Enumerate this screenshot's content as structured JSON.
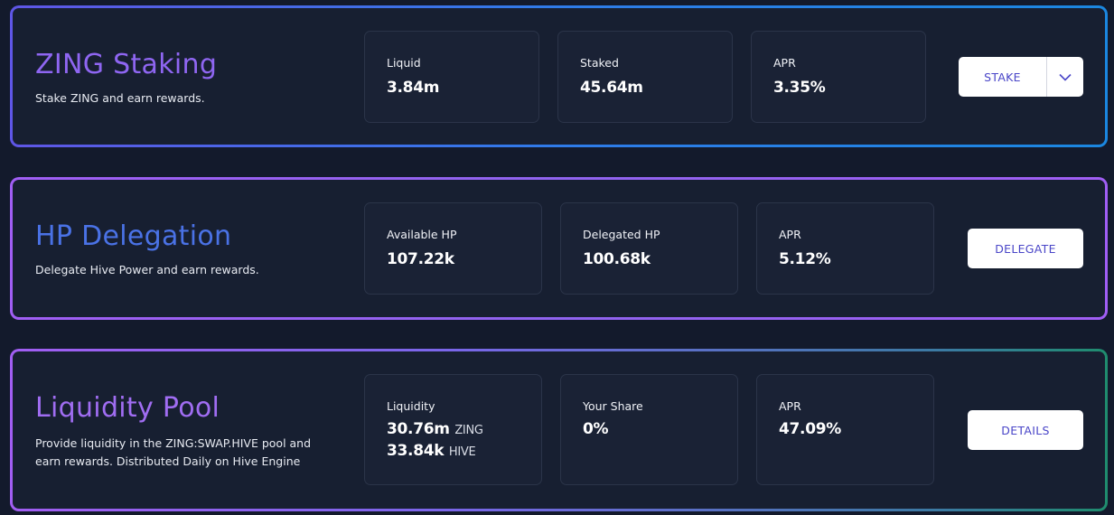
{
  "staking": {
    "title": "ZING Staking",
    "description": "Stake ZING and earn rewards.",
    "stats": [
      {
        "label": "Liquid",
        "value": "3.84m"
      },
      {
        "label": "Staked",
        "value": "45.64m"
      },
      {
        "label": "APR",
        "value": "3.35%"
      }
    ],
    "button_label": "STAKE",
    "dropdown_icon": "chevron-down-icon"
  },
  "delegation": {
    "title": "HP Delegation",
    "description": "Delegate Hive Power and earn rewards.",
    "stats": [
      {
        "label": "Available HP",
        "value": "107.22k"
      },
      {
        "label": "Delegated HP",
        "value": "100.68k"
      },
      {
        "label": "APR",
        "value": "5.12%"
      }
    ],
    "button_label": "DELEGATE"
  },
  "pool": {
    "title": "Liquidity Pool",
    "description": "Provide liquidity in the ZING:SWAP.HIVE pool and earn rewards. Distributed Daily on Hive Engine",
    "liquidity": {
      "label": "Liquidity",
      "zing_value": "30.76m",
      "zing_unit": "ZING",
      "hive_value": "33.84k",
      "hive_unit": "HIVE"
    },
    "stats": [
      {
        "label": "Your Share",
        "value": "0%"
      },
      {
        "label": "APR",
        "value": "47.09%"
      }
    ],
    "button_label": "DETAILS"
  },
  "colors": {
    "accent_purple": "#8f66f2",
    "accent_blue": "#4a72e6",
    "button_text": "#4a46c8",
    "background": "#131a2c"
  }
}
